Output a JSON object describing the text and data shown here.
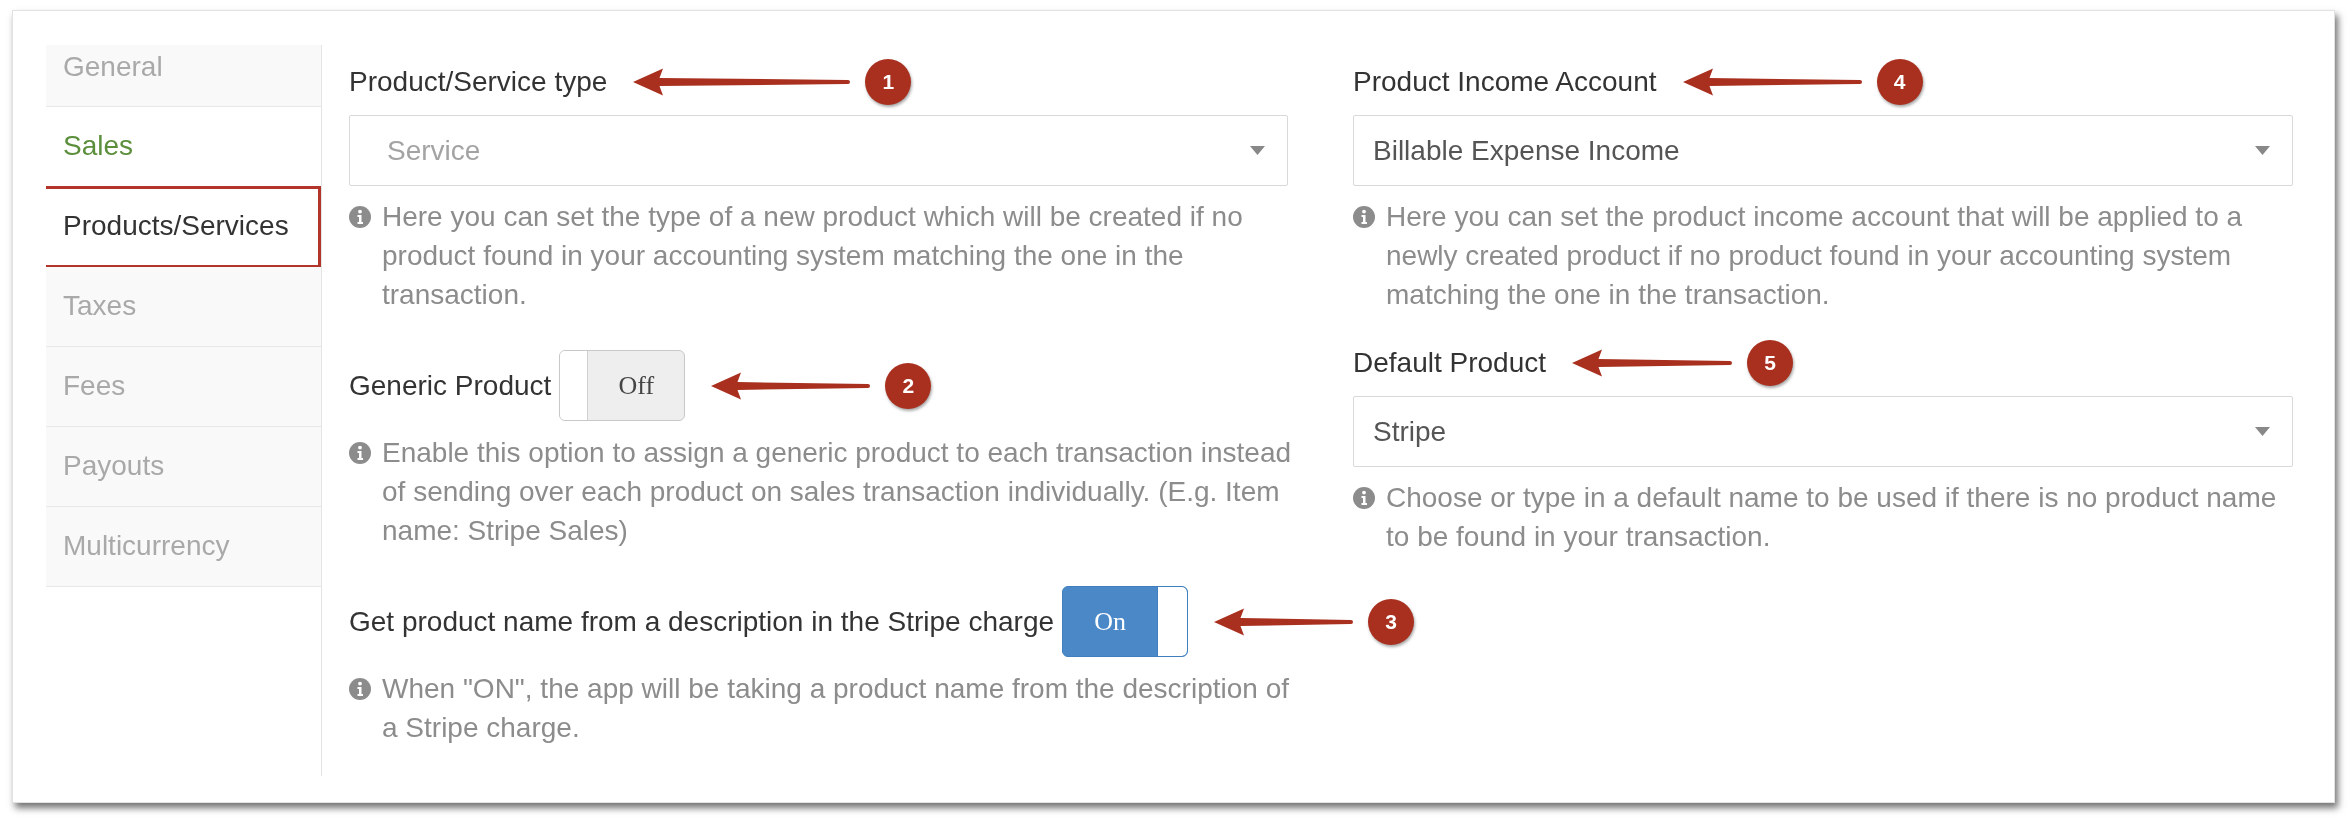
{
  "sidebar": {
    "items": [
      {
        "label": "General",
        "selected": false,
        "disabled": true
      },
      {
        "label": "Sales",
        "selected": false,
        "disabled": false
      },
      {
        "label": "Products/Services",
        "selected": true,
        "disabled": false
      },
      {
        "label": "Taxes",
        "selected": false,
        "disabled": true
      },
      {
        "label": "Fees",
        "selected": false,
        "disabled": true
      },
      {
        "label": "Payouts",
        "selected": false,
        "disabled": true
      },
      {
        "label": "Multicurrency",
        "selected": false,
        "disabled": true
      }
    ]
  },
  "columns": [
    {
      "fields": [
        {
          "kind": "select",
          "label": "Product/Service type",
          "placeholder": "Service",
          "callout": "1",
          "help": "Here you can set the type of a new product which will be created if no product found in your accounting system matching the one in the transaction."
        },
        {
          "kind": "toggle",
          "label": "Generic Product",
          "on": false,
          "switch_text": "Off",
          "callout": "2",
          "help": "Enable this option to assign a generic product to each transaction instead of sending over each product on sales transaction individually. (E.g. Item name: Stripe Sales)"
        },
        {
          "kind": "toggle",
          "label": "Get product name from a description in the Stripe charge",
          "on": true,
          "switch_text": "On",
          "callout": "3",
          "help": "When \"ON\", the app will be taking a product name from the description of a Stripe charge."
        }
      ]
    },
    {
      "fields": [
        {
          "kind": "select",
          "label": "Product Income Account",
          "value": "Billable Expense Income",
          "callout": "4",
          "help": "Here you can set the product income account that will be applied to a newly created product if no product found in your accounting system matching the one in the transaction."
        },
        {
          "kind": "select",
          "label": "Default Product",
          "value": "Stripe",
          "callout": "5",
          "help": "Choose or type in a default name to be used if there is no product name to be found in your transaction."
        }
      ]
    }
  ]
}
